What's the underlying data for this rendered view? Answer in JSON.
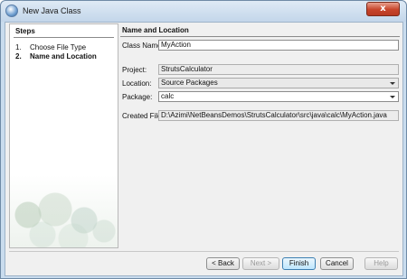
{
  "window": {
    "title": "New Java Class",
    "close_label": "x"
  },
  "steps": {
    "title": "Steps",
    "items": [
      {
        "num": "1.",
        "label": "Choose File Type"
      },
      {
        "num": "2.",
        "label": "Name and Location"
      }
    ]
  },
  "main": {
    "title": "Name and Location",
    "class_name": {
      "label": "Class Name:",
      "value": "MyAction"
    },
    "project": {
      "label": "Project:",
      "value": "StrutsCalculator"
    },
    "location": {
      "label": "Location:",
      "value": "Source Packages"
    },
    "package": {
      "label": "Package:",
      "value": "calc"
    },
    "created_file": {
      "label": "Created File:",
      "value": "D:\\Azimi\\NetBeansDemos\\StrutsCalculator\\src\\java\\calc\\MyAction.java"
    }
  },
  "buttons": {
    "back": "< Back",
    "next": "Next >",
    "finish": "Finish",
    "cancel": "Cancel",
    "help": "Help"
  },
  "colors": {
    "title_bar": "#c9dcee",
    "close_button": "#c7442a",
    "default_button": "#bee6fd"
  }
}
